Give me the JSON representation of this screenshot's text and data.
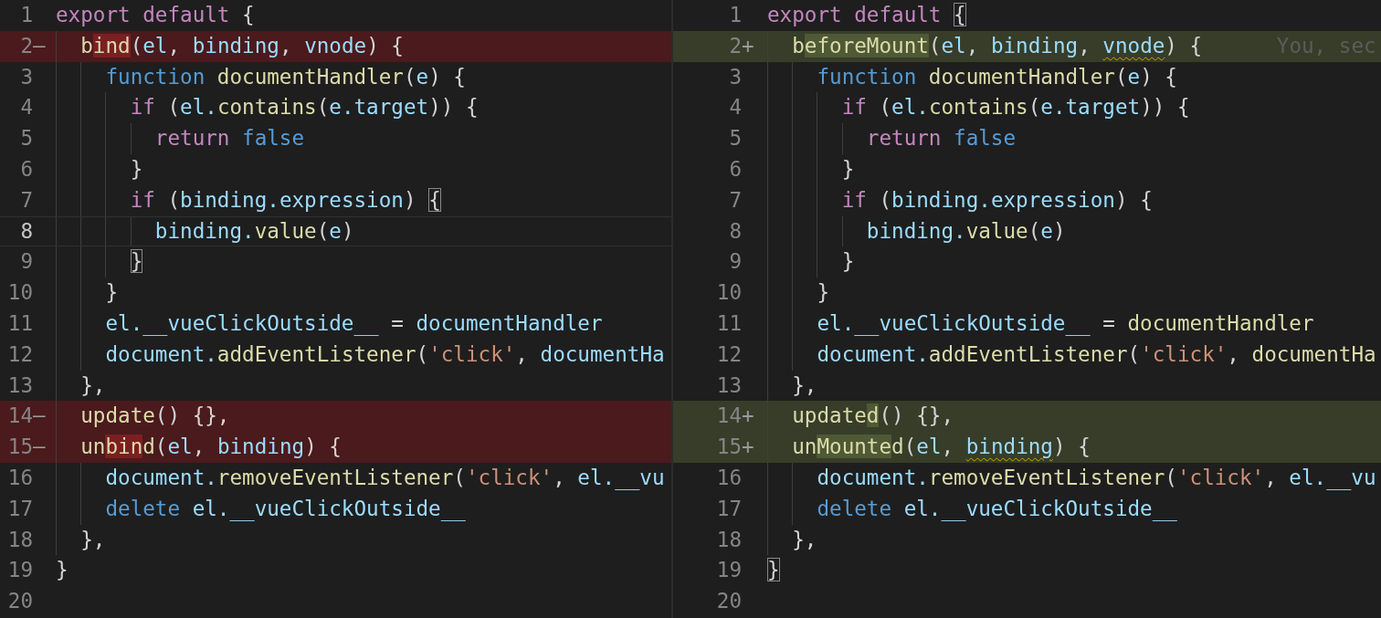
{
  "left": {
    "lines": [
      {
        "number": "1",
        "kind": "context",
        "current": false,
        "tokens": [
          {
            "kind": "kw",
            "text": "export default "
          },
          {
            "kind": "p",
            "text": "{"
          }
        ]
      },
      {
        "number": "2",
        "marker": "—",
        "kind": "removed",
        "current": false,
        "tokens": [
          {
            "kind": "fn",
            "text": "  b"
          },
          {
            "kind": "fn",
            "text": "ind",
            "highlight": true
          },
          {
            "kind": "p",
            "text": "("
          },
          {
            "kind": "vr",
            "text": "el"
          },
          {
            "kind": "p",
            "text": ", "
          },
          {
            "kind": "vr",
            "text": "binding"
          },
          {
            "kind": "p",
            "text": ", "
          },
          {
            "kind": "vr",
            "text": "vnode"
          },
          {
            "kind": "p",
            "text": ") {"
          }
        ]
      },
      {
        "number": "3",
        "kind": "context",
        "current": false,
        "tokens": [
          {
            "kind": "st",
            "text": "    function "
          },
          {
            "kind": "fn",
            "text": "documentHandler"
          },
          {
            "kind": "p",
            "text": "("
          },
          {
            "kind": "vr",
            "text": "e"
          },
          {
            "kind": "p",
            "text": ") {"
          }
        ]
      },
      {
        "number": "4",
        "kind": "context",
        "current": false,
        "tokens": [
          {
            "kind": "kw",
            "text": "      if"
          },
          {
            "kind": "p",
            "text": " ("
          },
          {
            "kind": "vr",
            "text": "el."
          },
          {
            "kind": "fn",
            "text": "contains"
          },
          {
            "kind": "p",
            "text": "("
          },
          {
            "kind": "vr",
            "text": "e.target"
          },
          {
            "kind": "p",
            "text": ")) {"
          }
        ]
      },
      {
        "number": "5",
        "kind": "context",
        "current": false,
        "tokens": [
          {
            "kind": "kw",
            "text": "        return "
          },
          {
            "kind": "st",
            "text": "false"
          }
        ]
      },
      {
        "number": "6",
        "kind": "context",
        "current": false,
        "tokens": [
          {
            "kind": "p",
            "text": "      }"
          }
        ]
      },
      {
        "number": "7",
        "kind": "context",
        "current": false,
        "tokens": [
          {
            "kind": "kw",
            "text": "      if"
          },
          {
            "kind": "p",
            "text": " ("
          },
          {
            "kind": "vr",
            "text": "binding.expression"
          },
          {
            "kind": "p",
            "text": ") "
          },
          {
            "kind": "p",
            "text": "{",
            "bracket_match": true
          }
        ]
      },
      {
        "number": "8",
        "kind": "context",
        "current": true,
        "tokens": [
          {
            "kind": "vr",
            "text": "        binding."
          },
          {
            "kind": "fn",
            "text": "value"
          },
          {
            "kind": "p",
            "text": "("
          },
          {
            "kind": "vr",
            "text": "e"
          },
          {
            "kind": "p",
            "text": ")"
          }
        ]
      },
      {
        "number": "9",
        "kind": "context",
        "current": false,
        "tokens": [
          {
            "kind": "p",
            "text": "      }",
            "bracket_match": true
          }
        ]
      },
      {
        "number": "10",
        "kind": "context",
        "current": false,
        "tokens": [
          {
            "kind": "p",
            "text": "    }"
          }
        ]
      },
      {
        "number": "11",
        "kind": "context",
        "current": false,
        "tokens": [
          {
            "kind": "vr",
            "text": "    el.__vueClickOutside__"
          },
          {
            "kind": "p",
            "text": " = "
          },
          {
            "kind": "vr",
            "text": "documentHandler"
          }
        ]
      },
      {
        "number": "12",
        "kind": "context",
        "current": false,
        "tokens": [
          {
            "kind": "vr",
            "text": "    document."
          },
          {
            "kind": "fn",
            "text": "addEventListener"
          },
          {
            "kind": "p",
            "text": "("
          },
          {
            "kind": "str",
            "text": "'click'"
          },
          {
            "kind": "p",
            "text": ", "
          },
          {
            "kind": "vr",
            "text": "documentHa"
          }
        ]
      },
      {
        "number": "13",
        "kind": "context",
        "current": false,
        "tokens": [
          {
            "kind": "p",
            "text": "  },"
          }
        ]
      },
      {
        "number": "14",
        "marker": "—",
        "kind": "removed",
        "current": false,
        "tokens": [
          {
            "kind": "fn",
            "text": "  update"
          },
          {
            "kind": "p",
            "text": "() {},"
          }
        ]
      },
      {
        "number": "15",
        "marker": "—",
        "kind": "removed",
        "current": false,
        "tokens": [
          {
            "kind": "fn",
            "text": "  un"
          },
          {
            "kind": "fn",
            "text": "bin",
            "highlight": true
          },
          {
            "kind": "fn",
            "text": "d"
          },
          {
            "kind": "p",
            "text": "("
          },
          {
            "kind": "vr",
            "text": "el"
          },
          {
            "kind": "p",
            "text": ", "
          },
          {
            "kind": "vr",
            "text": "binding"
          },
          {
            "kind": "p",
            "text": ") {"
          }
        ]
      },
      {
        "number": "16",
        "kind": "context",
        "current": false,
        "tokens": [
          {
            "kind": "vr",
            "text": "    document."
          },
          {
            "kind": "fn",
            "text": "removeEventListener"
          },
          {
            "kind": "p",
            "text": "("
          },
          {
            "kind": "str",
            "text": "'click'"
          },
          {
            "kind": "p",
            "text": ", "
          },
          {
            "kind": "vr",
            "text": "el.__vu"
          }
        ]
      },
      {
        "number": "17",
        "kind": "context",
        "current": false,
        "tokens": [
          {
            "kind": "st",
            "text": "    delete "
          },
          {
            "kind": "vr",
            "text": "el.__vueClickOutside__"
          }
        ]
      },
      {
        "number": "18",
        "kind": "context",
        "current": false,
        "tokens": [
          {
            "kind": "p",
            "text": "  },"
          }
        ]
      },
      {
        "number": "19",
        "kind": "context",
        "current": false,
        "tokens": [
          {
            "kind": "p",
            "text": "}"
          }
        ]
      },
      {
        "number": "20",
        "kind": "context",
        "current": false
      }
    ]
  },
  "right": {
    "lines": [
      {
        "number": "1",
        "kind": "context",
        "current": false,
        "tokens": [
          {
            "kind": "kw",
            "text": "export default "
          },
          {
            "kind": "p",
            "text": "{",
            "bracket_match": true
          }
        ]
      },
      {
        "number": "2",
        "marker": "+",
        "kind": "added",
        "current": false,
        "tokens": [
          {
            "kind": "fn",
            "text": "  b"
          },
          {
            "kind": "fn",
            "text": "eforeMount",
            "highlight": true
          },
          {
            "kind": "p",
            "text": "("
          },
          {
            "kind": "vr",
            "text": "el"
          },
          {
            "kind": "p",
            "text": ", "
          },
          {
            "kind": "vr",
            "text": "binding"
          },
          {
            "kind": "p",
            "text": ", "
          },
          {
            "kind": "vr",
            "text": "vnode",
            "warning": true
          },
          {
            "kind": "p",
            "text": ") {"
          },
          {
            "kind": "gh",
            "text": "      You, sec"
          }
        ]
      },
      {
        "number": "3",
        "kind": "context",
        "current": false,
        "tokens": [
          {
            "kind": "st",
            "text": "    function "
          },
          {
            "kind": "fn",
            "text": "documentHandler"
          },
          {
            "kind": "p",
            "text": "("
          },
          {
            "kind": "vr",
            "text": "e"
          },
          {
            "kind": "p",
            "text": ") {"
          }
        ]
      },
      {
        "number": "4",
        "kind": "context",
        "current": false,
        "tokens": [
          {
            "kind": "kw",
            "text": "      if"
          },
          {
            "kind": "p",
            "text": " ("
          },
          {
            "kind": "vr",
            "text": "el."
          },
          {
            "kind": "fn",
            "text": "contains"
          },
          {
            "kind": "p",
            "text": "("
          },
          {
            "kind": "vr",
            "text": "e.target"
          },
          {
            "kind": "p",
            "text": ")) {"
          }
        ]
      },
      {
        "number": "5",
        "kind": "context",
        "current": false,
        "tokens": [
          {
            "kind": "kw",
            "text": "        return "
          },
          {
            "kind": "st",
            "text": "false"
          }
        ]
      },
      {
        "number": "6",
        "kind": "context",
        "current": false,
        "tokens": [
          {
            "kind": "p",
            "text": "      }"
          }
        ]
      },
      {
        "number": "7",
        "kind": "context",
        "current": false,
        "tokens": [
          {
            "kind": "kw",
            "text": "      if"
          },
          {
            "kind": "p",
            "text": " ("
          },
          {
            "kind": "vr",
            "text": "binding.expression"
          },
          {
            "kind": "p",
            "text": ") {"
          }
        ]
      },
      {
        "number": "8",
        "kind": "context",
        "current": false,
        "tokens": [
          {
            "kind": "vr",
            "text": "        binding."
          },
          {
            "kind": "fn",
            "text": "value"
          },
          {
            "kind": "p",
            "text": "("
          },
          {
            "kind": "vr",
            "text": "e"
          },
          {
            "kind": "p",
            "text": ")"
          }
        ]
      },
      {
        "number": "9",
        "kind": "context",
        "current": false,
        "tokens": [
          {
            "kind": "p",
            "text": "      }"
          }
        ]
      },
      {
        "number": "10",
        "kind": "context",
        "current": false,
        "tokens": [
          {
            "kind": "p",
            "text": "    }"
          }
        ]
      },
      {
        "number": "11",
        "kind": "context",
        "current": false,
        "tokens": [
          {
            "kind": "vr",
            "text": "    el.__vueClickOutside__"
          },
          {
            "kind": "p",
            "text": " = "
          },
          {
            "kind": "fn",
            "text": "documentHandler"
          }
        ]
      },
      {
        "number": "12",
        "kind": "context",
        "current": false,
        "tokens": [
          {
            "kind": "vr",
            "text": "    document."
          },
          {
            "kind": "fn",
            "text": "addEventListener"
          },
          {
            "kind": "p",
            "text": "("
          },
          {
            "kind": "str",
            "text": "'click'"
          },
          {
            "kind": "p",
            "text": ", "
          },
          {
            "kind": "fn",
            "text": "documentHa"
          }
        ]
      },
      {
        "number": "13",
        "kind": "context",
        "current": false,
        "tokens": [
          {
            "kind": "p",
            "text": "  },"
          }
        ]
      },
      {
        "number": "14",
        "marker": "+",
        "kind": "added",
        "current": false,
        "tokens": [
          {
            "kind": "fn",
            "text": "  update"
          },
          {
            "kind": "fn",
            "text": "d",
            "highlight": true
          },
          {
            "kind": "p",
            "text": "() {},"
          }
        ]
      },
      {
        "number": "15",
        "marker": "+",
        "kind": "added",
        "current": false,
        "tokens": [
          {
            "kind": "fn",
            "text": "  un"
          },
          {
            "kind": "fn",
            "text": "Mounte",
            "highlight": true
          },
          {
            "kind": "fn",
            "text": "d"
          },
          {
            "kind": "p",
            "text": "("
          },
          {
            "kind": "vr",
            "text": "el"
          },
          {
            "kind": "p",
            "text": ", "
          },
          {
            "kind": "vr",
            "text": "binding",
            "warning": true
          },
          {
            "kind": "p",
            "text": ") {"
          }
        ]
      },
      {
        "number": "16",
        "kind": "context",
        "current": false,
        "tokens": [
          {
            "kind": "vr",
            "text": "    document."
          },
          {
            "kind": "fn",
            "text": "removeEventListener"
          },
          {
            "kind": "p",
            "text": "("
          },
          {
            "kind": "str",
            "text": "'click'"
          },
          {
            "kind": "p",
            "text": ", "
          },
          {
            "kind": "vr",
            "text": "el.__vu"
          }
        ]
      },
      {
        "number": "17",
        "kind": "context",
        "current": false,
        "tokens": [
          {
            "kind": "st",
            "text": "    delete "
          },
          {
            "kind": "vr",
            "text": "el.__vueClickOutside__"
          }
        ]
      },
      {
        "number": "18",
        "kind": "context",
        "current": false,
        "tokens": [
          {
            "kind": "p",
            "text": "  },"
          }
        ]
      },
      {
        "number": "19",
        "kind": "context",
        "current": false,
        "tokens": [
          {
            "kind": "p",
            "text": "}",
            "bracket_match": true
          }
        ]
      },
      {
        "number": "20",
        "kind": "context",
        "current": false
      }
    ]
  }
}
